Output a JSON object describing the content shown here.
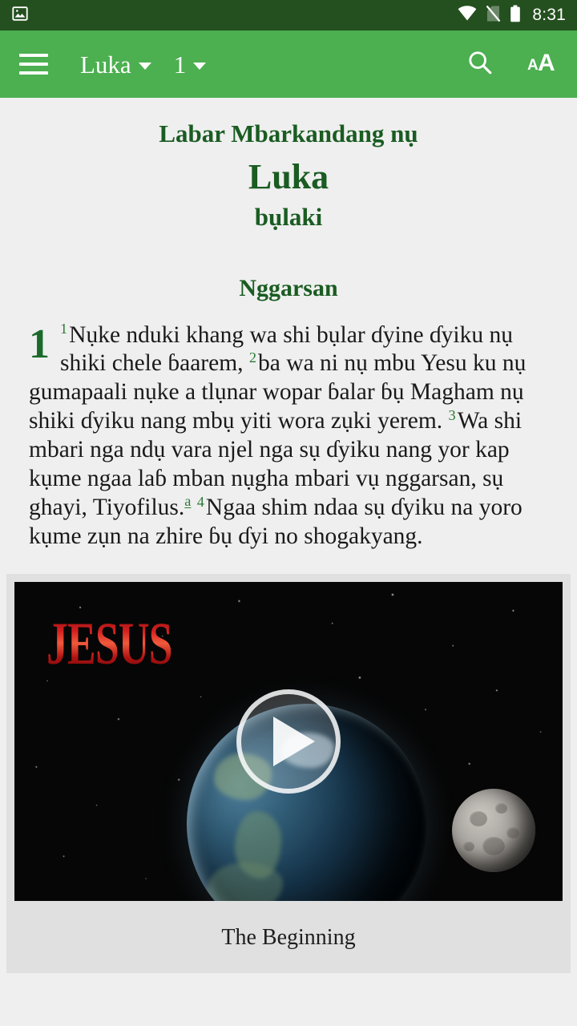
{
  "status_bar": {
    "notification_icon": "image-icon",
    "icons": [
      "wifi-icon",
      "no-sim-icon",
      "battery-icon"
    ],
    "time": "8:31",
    "background_color": "#24501f"
  },
  "toolbar": {
    "menu_icon": "hamburger-menu-icon",
    "book_label": "Luka",
    "chapter_label": "1",
    "search_icon": "search-icon",
    "text_size_icon": "text-size-icon",
    "background_color": "#4caf50"
  },
  "book_header": {
    "subtitle_top": "Labar Mbarkandang nụ",
    "title": "Luka",
    "subtitle_bottom": "bụlaki",
    "color": "#1a5c22"
  },
  "section": {
    "heading": "Nggarsan"
  },
  "passage": {
    "chapter_number": "1",
    "verses": [
      {
        "number": "1",
        "text": "Nụke nduki khang wa shi bụlar ɗyine ɗyiku nụ shiki chele ɓaarem,"
      },
      {
        "number": "2",
        "text": "ba wa ni nụ mbu Yesu ku nụ gumapaali nụke a tlụnar wopar ɓalar ɓụ Magham nụ shiki ɗyiku nang mbụ yiti wora zụki yerem."
      },
      {
        "number": "3",
        "text": "Wa shi mbari nga ndụ vara njel nga sụ ɗyiku nang yor kap kụme ngaa laɓ mban nụgha mbari vụ nggarsan, sụ ghayi, Tiyofilus."
      },
      {
        "number": "4",
        "text": "Ngaa shim ndaa sụ ɗyiku na yoro kụme zụn na zhire ɓụ ɗyi no shogakyang."
      }
    ],
    "footnote_marker": "a",
    "verse_number_color": "#2c7a35",
    "chapter_number_color": "#1a6b2a"
  },
  "media": {
    "logo_text": "JESUS",
    "play_icon": "play-button-icon",
    "caption": "The Beginning",
    "thumbnail_description": "earth-and-moon-starfield-thumbnail"
  }
}
